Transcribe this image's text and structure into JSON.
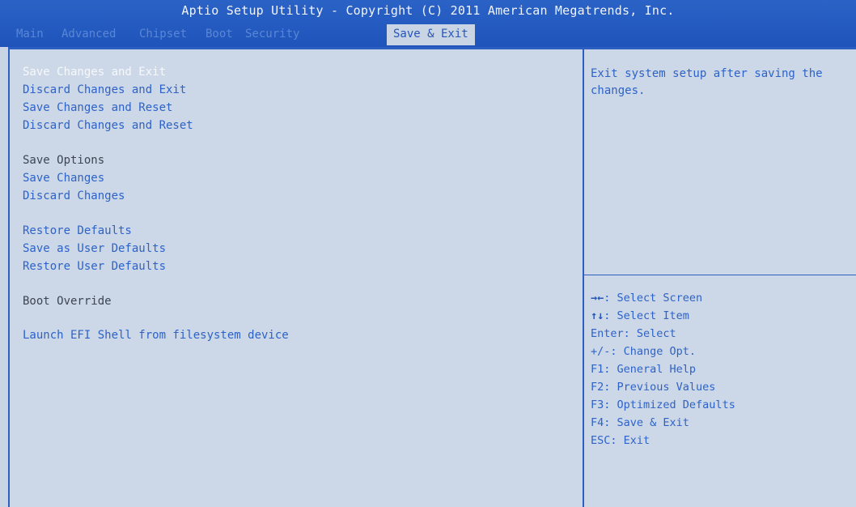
{
  "header": {
    "title": "Aptio Setup Utility - Copyright (C) 2011 American Megatrends, Inc.",
    "tabs": [
      {
        "label": "Main"
      },
      {
        "label": "Advanced"
      },
      {
        "label": "Chipset"
      },
      {
        "label": "Boot"
      },
      {
        "label": "Security"
      },
      {
        "label": "Save & Exit",
        "active": true
      }
    ]
  },
  "menu": {
    "items": [
      {
        "label": "Save Changes and Exit",
        "selected": true
      },
      {
        "label": "Discard Changes and Exit"
      },
      {
        "label": "Save Changes and Reset"
      },
      {
        "label": "Discard Changes and Reset"
      },
      {
        "label": "Save Options",
        "type": "heading"
      },
      {
        "label": "Save Changes"
      },
      {
        "label": "Discard Changes"
      },
      {
        "label": "Restore Defaults"
      },
      {
        "label": "Save as User Defaults"
      },
      {
        "label": "Restore User Defaults"
      },
      {
        "label": "Boot Override",
        "type": "heading"
      },
      {
        "label": "Launch EFI Shell from filesystem device"
      }
    ]
  },
  "help": {
    "text": "Exit system setup after saving the changes."
  },
  "keys": [
    {
      "key": "→←",
      "desc": ": Select Screen"
    },
    {
      "key": "↑↓",
      "desc": ": Select Item"
    },
    {
      "key": "Enter",
      "desc": ": Select"
    },
    {
      "key": "+/-",
      "desc": ": Change Opt."
    },
    {
      "key": "F1",
      "desc": ": General Help"
    },
    {
      "key": "F2",
      "desc": ": Previous Values"
    },
    {
      "key": "F3",
      "desc": ": Optimized Defaults"
    },
    {
      "key": "F4",
      "desc": ": Save & Exit"
    },
    {
      "key": "ESC",
      "desc": ": Exit"
    }
  ],
  "colors": {
    "header_bg": "#1f55bb",
    "panel_bg": "#ccd7e7",
    "item_text": "#2d63c8",
    "selected_text": "#f7f8fb",
    "heading_text": "#3d4552"
  }
}
